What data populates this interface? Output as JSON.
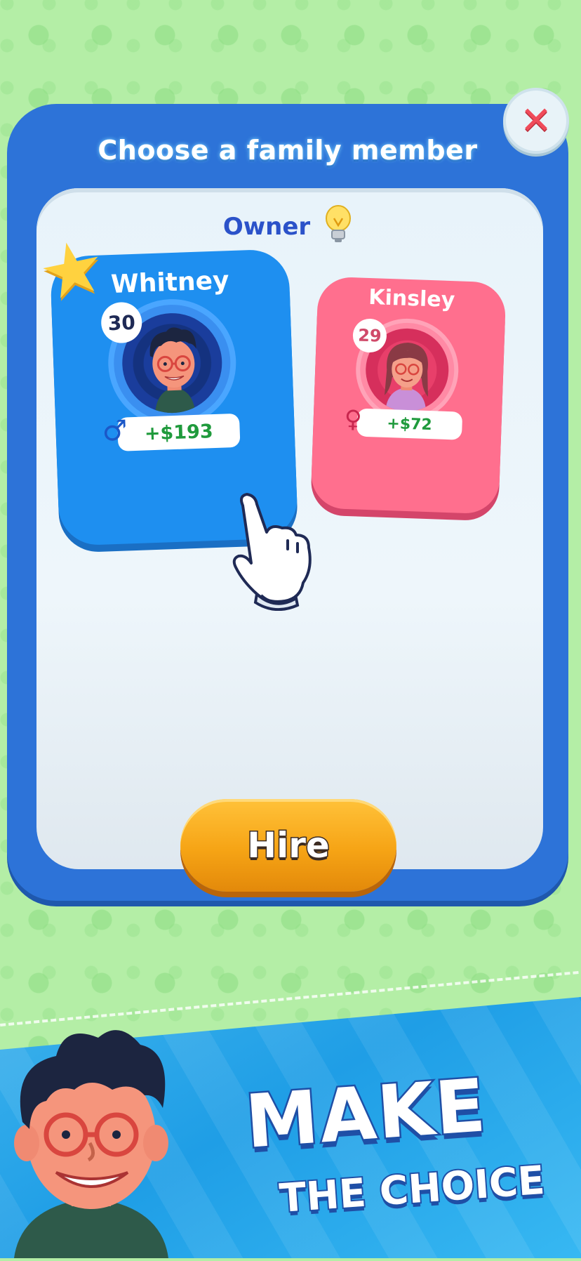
{
  "dialog": {
    "title": "Choose a family member",
    "section_label": "Owner",
    "section_icon": "lightbulb-icon"
  },
  "members": [
    {
      "name": "Whitney",
      "age": "30",
      "income": "+$193",
      "gender_icon": "male-icon",
      "selected": true,
      "card_color": "#1e8ff0"
    },
    {
      "name": "Kinsley",
      "age": "29",
      "income": "+$72",
      "gender_icon": "female-icon",
      "selected": false,
      "card_color": "#ff6f8e"
    }
  ],
  "actions": {
    "hire_label": "Hire",
    "close_icon": "close-icon"
  },
  "promo": {
    "line1": "MAKE",
    "line2": "THE CHOICE"
  },
  "colors": {
    "background": "#b4eea6",
    "dialog": "#2d73d8",
    "hire_button": "#f6a415",
    "income_text": "#1f9a3c"
  }
}
